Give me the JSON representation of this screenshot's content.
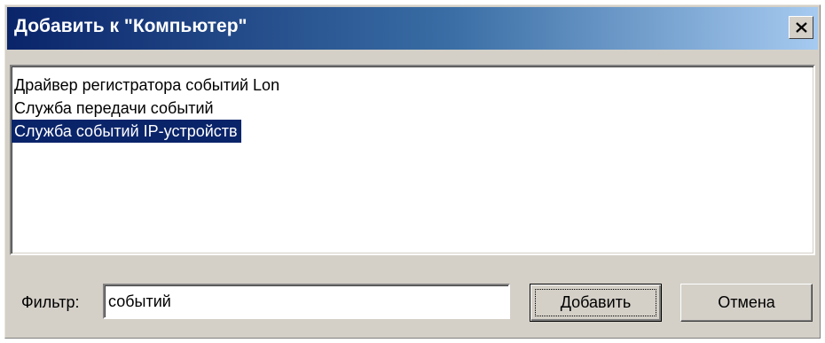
{
  "window": {
    "title": "Добавить к \"Компьютер\"",
    "close_icon": "close-icon"
  },
  "list": {
    "items": [
      {
        "label": "Драйвер регистратора событий Lon",
        "selected": false
      },
      {
        "label": "Служба передачи событий",
        "selected": false
      },
      {
        "label": "Служба событий IP-устройств",
        "selected": true
      }
    ]
  },
  "filter": {
    "label": "Фильтр:",
    "value": "событий"
  },
  "buttons": {
    "add_label": "Добавить",
    "cancel_label": "Отмена"
  },
  "colors": {
    "title_gradient_start": "#0a246a",
    "title_gradient_end": "#a6caf0",
    "selection": "#0a246a",
    "dialog_face": "#d4d0c8"
  }
}
